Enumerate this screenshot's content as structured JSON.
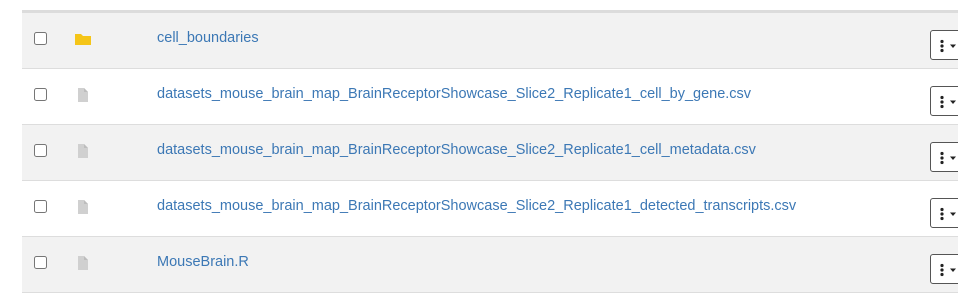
{
  "files": [
    {
      "name": "cell_boundaries",
      "type": "folder",
      "icon": "folder-icon",
      "icon_color": "#f5c518"
    },
    {
      "name": "datasets_mouse_brain_map_BrainReceptorShowcase_Slice2_Replicate1_cell_by_gene.csv",
      "type": "file",
      "icon": "file-icon",
      "icon_color": "#d0d0d0"
    },
    {
      "name": "datasets_mouse_brain_map_BrainReceptorShowcase_Slice2_Replicate1_cell_metadata.csv",
      "type": "file",
      "icon": "file-icon",
      "icon_color": "#d0d0d0"
    },
    {
      "name": "datasets_mouse_brain_map_BrainReceptorShowcase_Slice2_Replicate1_detected_transcripts.csv",
      "type": "file",
      "icon": "file-icon",
      "icon_color": "#d0d0d0"
    },
    {
      "name": "MouseBrain.R",
      "type": "file",
      "icon": "file-icon",
      "icon_color": "#d0d0d0"
    }
  ],
  "row_actions": {
    "icon": "vertical-ellipsis-caret-icon"
  },
  "colors": {
    "link": "#3c78b5",
    "row_alt": "#f2f2f2"
  }
}
